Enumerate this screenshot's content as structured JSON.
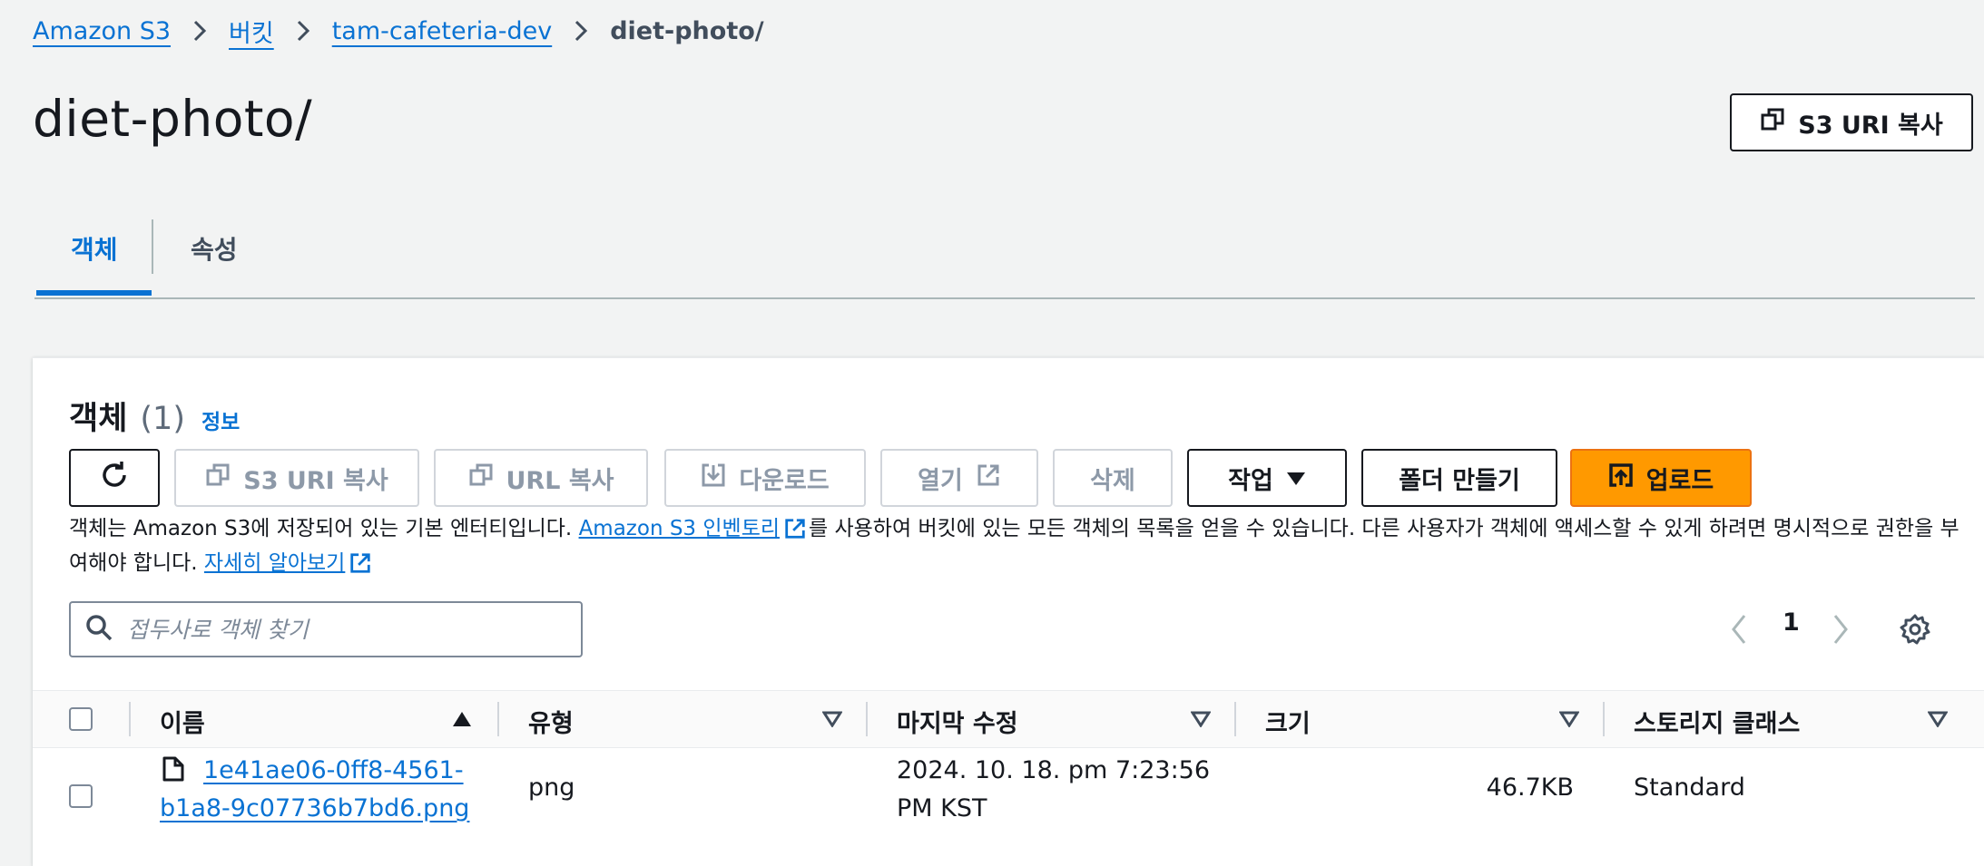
{
  "breadcrumb": {
    "items": [
      "Amazon S3",
      "버킷",
      "tam-cafeteria-dev"
    ],
    "current": "diet-photo/"
  },
  "page": {
    "title": "diet-photo/",
    "copy_uri_label": "S3 URI 복사"
  },
  "tabs": [
    {
      "label": "객체",
      "active": true
    },
    {
      "label": "속성",
      "active": false
    }
  ],
  "objects_panel": {
    "title": "객체",
    "count": "(1)",
    "info_link": "정보",
    "buttons": {
      "copy_s3_uri": "S3 URI 복사",
      "copy_url": "URL 복사",
      "download": "다운로드",
      "open": "열기",
      "delete": "삭제",
      "actions": "작업",
      "create_folder": "폴더 만들기",
      "upload": "업로드"
    },
    "description": {
      "part1": "객체는 Amazon S3에 저장되어 있는 기본 엔터티입니다. ",
      "inventory_link": "Amazon S3 인벤토리",
      "part2": "를 사용하여 버킷에 있는 모든 객체의 목록을 얻을 수 있습니다. 다른 사용자가 객체에 액세스할 수 있게 하려면 명시적으로 권한을 부여해야 합니다. ",
      "learn_more_link": "자세히 알아보기"
    },
    "search_placeholder": "접두사로 객체 찾기",
    "pagination": {
      "current_page": "1"
    },
    "table": {
      "columns": [
        "이름",
        "유형",
        "마지막 수정",
        "크기",
        "스토리지 클래스"
      ],
      "rows": [
        {
          "name_line1": "1e41ae06-0ff8-4561-",
          "name_line2": "b1a8-9c07736b7bd6.png",
          "type": "png",
          "modified_line1": "2024. 10. 18. pm 7:23:56",
          "modified_line2": "PM KST",
          "size": "46.7KB",
          "storage_class": "Standard"
        }
      ]
    }
  },
  "colors": {
    "link": "#0972d3",
    "primary_button": "#ff9900",
    "page_bg": "#f2f3f3"
  }
}
